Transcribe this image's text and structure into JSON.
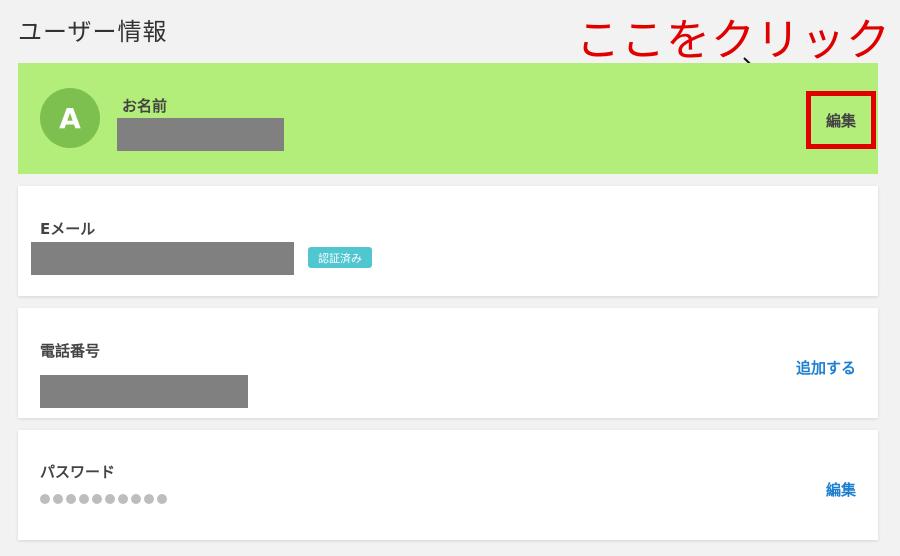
{
  "page": {
    "title": "ユーザー情報"
  },
  "annotation": {
    "text": "ここをクリック",
    "color": "#e00000"
  },
  "name_card": {
    "avatar_letter": "A",
    "label": "お名前",
    "edit_label": "編集",
    "background": "#b4ee7a"
  },
  "email_card": {
    "label": "Eメール",
    "badge": "認証済み"
  },
  "phone_card": {
    "label": "電話番号",
    "action_label": "追加する"
  },
  "password_card": {
    "label": "パスワード",
    "action_label": "編集",
    "masked_length": 10
  },
  "colors": {
    "link": "#1e7fd1",
    "badge": "#4fc6d0",
    "avatar": "#7ec04f"
  }
}
